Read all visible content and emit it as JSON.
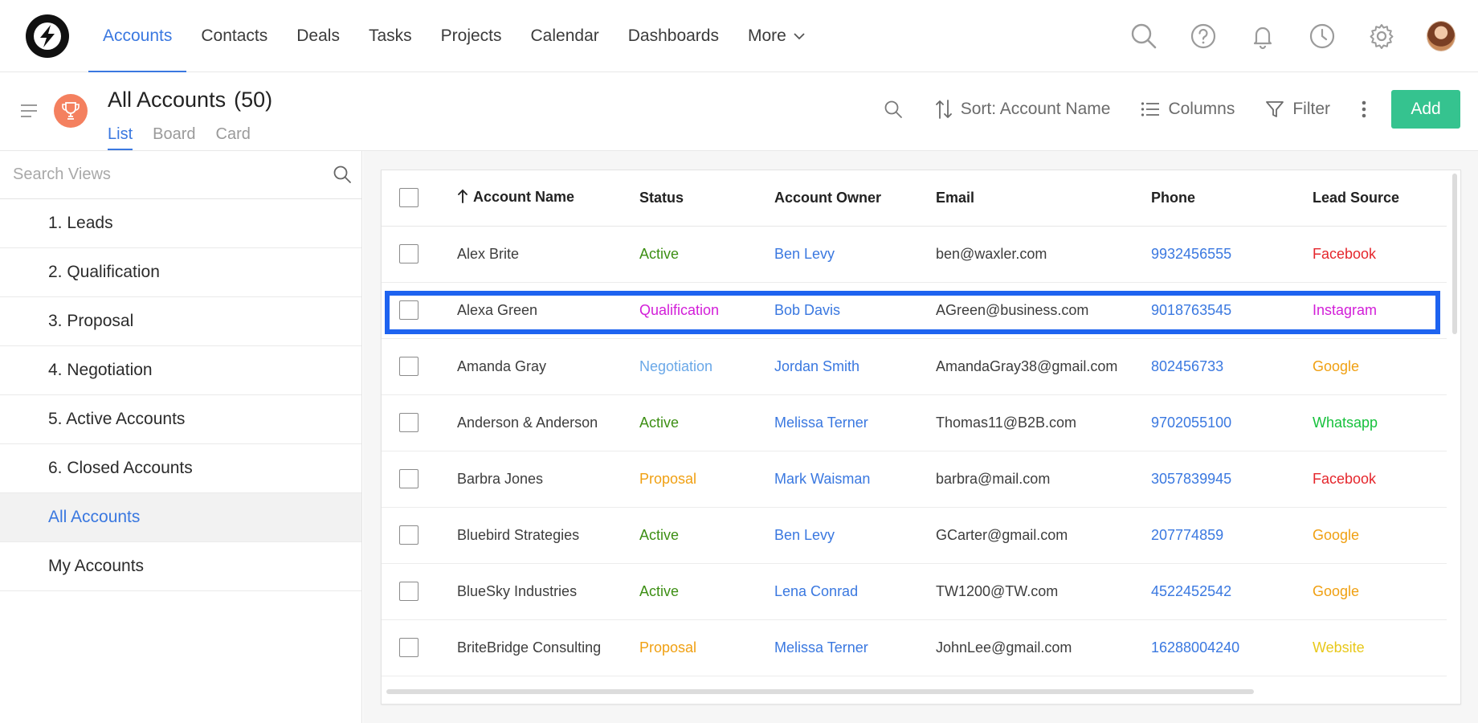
{
  "nav": {
    "items": [
      {
        "label": "Accounts",
        "active": true
      },
      {
        "label": "Contacts"
      },
      {
        "label": "Deals"
      },
      {
        "label": "Tasks"
      },
      {
        "label": "Projects"
      },
      {
        "label": "Calendar"
      },
      {
        "label": "Dashboards"
      }
    ],
    "more_label": "More",
    "icons": [
      "search-icon",
      "help-icon",
      "bell-icon",
      "clock-icon",
      "gear-icon",
      "avatar"
    ]
  },
  "header": {
    "title": "All Accounts",
    "count": "(50)",
    "tabs": [
      {
        "label": "List",
        "active": true
      },
      {
        "label": "Board"
      },
      {
        "label": "Card"
      }
    ],
    "sort_label": "Sort: Account Name",
    "columns_label": "Columns",
    "filter_label": "Filter",
    "add_label": "Add"
  },
  "sidebar": {
    "search_placeholder": "Search Views",
    "items": [
      {
        "label": "1. Leads"
      },
      {
        "label": "2. Qualification"
      },
      {
        "label": "3. Proposal"
      },
      {
        "label": "4. Negotiation"
      },
      {
        "label": "5. Active Accounts"
      },
      {
        "label": "6. Closed Accounts"
      },
      {
        "label": "All Accounts",
        "active": true
      },
      {
        "label": "My Accounts"
      }
    ]
  },
  "table": {
    "columns": {
      "name": "Account Name",
      "status": "Status",
      "owner": "Account Owner",
      "email": "Email",
      "phone": "Phone",
      "lead": "Lead Source"
    },
    "rows": [
      {
        "name": "Alex Brite",
        "status": "Active",
        "owner": "Ben Levy",
        "email": "ben@waxler.com",
        "phone": "9932456555",
        "lead": "Facebook"
      },
      {
        "name": "Alexa Green",
        "status": "Qualification",
        "owner": "Bob Davis",
        "email": "AGreen@business.com",
        "phone": "9018763545",
        "lead": "Instagram"
      },
      {
        "name": "Amanda Gray",
        "status": "Negotiation",
        "owner": "Jordan Smith",
        "email": "AmandaGray38@gmail.com",
        "phone": "802456733",
        "lead": "Google"
      },
      {
        "name": "Anderson & Anderson",
        "status": "Active",
        "owner": "Melissa Terner",
        "email": "Thomas11@B2B.com",
        "phone": "9702055100",
        "lead": "Whatsapp"
      },
      {
        "name": "Barbra Jones",
        "status": "Proposal",
        "owner": "Mark Waisman",
        "email": "barbra@mail.com",
        "phone": "3057839945",
        "lead": "Facebook"
      },
      {
        "name": "Bluebird Strategies",
        "status": "Active",
        "owner": "Ben Levy",
        "email": "GCarter@gmail.com",
        "phone": "207774859",
        "lead": "Google"
      },
      {
        "name": "BlueSky Industries",
        "status": "Active",
        "owner": "Lena Conrad",
        "email": "TW1200@TW.com",
        "phone": "4522452542",
        "lead": "Google"
      },
      {
        "name": "BriteBridge Consulting",
        "status": "Proposal",
        "owner": "Melissa Terner",
        "email": "JohnLee@gmail.com",
        "phone": "16288004240",
        "lead": "Website"
      }
    ]
  },
  "colors": {
    "accent": "#3a78e0",
    "add_button": "#35c38f",
    "highlight": "#1e63f0",
    "status": {
      "Active": "#3d8f14",
      "Qualification": "#d21ed8",
      "Negotiation": "#6aa8e8",
      "Proposal": "#f0a012"
    },
    "lead": {
      "Facebook": "#e5262c",
      "Instagram": "#d21ed8",
      "Google": "#f0a012",
      "Whatsapp": "#16c13c",
      "Website": "#e8c81a"
    }
  }
}
